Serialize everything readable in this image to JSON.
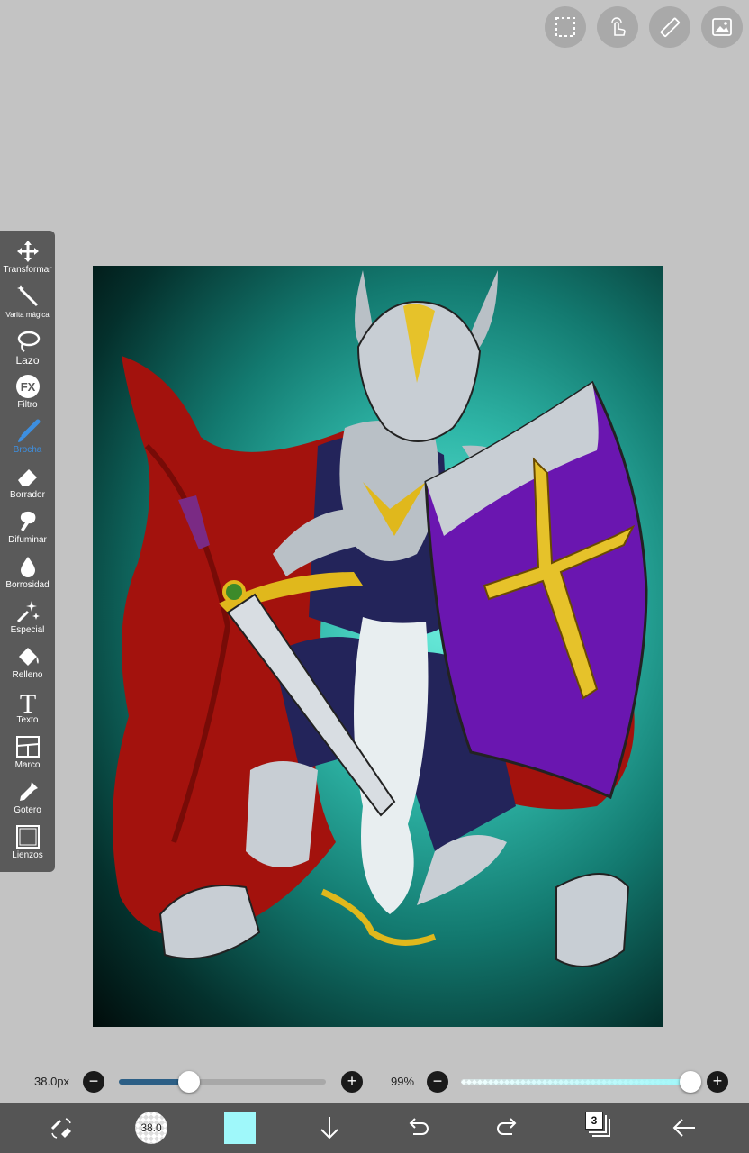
{
  "top_buttons": [
    {
      "name": "selection-icon"
    },
    {
      "name": "touch-gesture-icon"
    },
    {
      "name": "ruler-icon"
    },
    {
      "name": "reference-image-icon"
    }
  ],
  "toolbar": {
    "items": [
      {
        "label": "Transformar",
        "icon": "move-arrows-icon"
      },
      {
        "label": "Varita mágica",
        "icon": "magic-wand-icon"
      },
      {
        "label": "Lazo",
        "icon": "lasso-icon"
      },
      {
        "label": "Filtro",
        "icon": "fx-icon",
        "icon_text": "FX"
      },
      {
        "label": "Brocha",
        "icon": "brush-icon",
        "active": true
      },
      {
        "label": "Borrador",
        "icon": "eraser-icon"
      },
      {
        "label": "Difuminar",
        "icon": "smudge-finger-icon"
      },
      {
        "label": "Borrosidad",
        "icon": "blur-drop-icon"
      },
      {
        "label": "Especial",
        "icon": "sparkle-wand-icon"
      },
      {
        "label": "Relleno",
        "icon": "fill-bucket-icon"
      },
      {
        "label": "Texto",
        "icon": "text-t-icon",
        "icon_text": "T"
      },
      {
        "label": "Marco",
        "icon": "frame-divider-icon"
      },
      {
        "label": "Gotero",
        "icon": "eyedropper-icon"
      },
      {
        "label": "Lienzos",
        "icon": "canvas-icon"
      }
    ]
  },
  "sliders": {
    "size": {
      "value_label": "38.0px",
      "fraction": 0.34
    },
    "opacity": {
      "value_label": "99%",
      "fraction": 0.99
    },
    "minus": "−",
    "plus": "+"
  },
  "bottom_bar": {
    "brush_size_label": "38.0",
    "current_color": "#9ff8fa",
    "layer_count": "3",
    "icons": [
      "swap-tools-icon",
      "brush-size-icon",
      "color-swatch",
      "download-arrow-icon",
      "undo-icon",
      "redo-icon",
      "layers-icon",
      "back-arrow-icon"
    ]
  },
  "colors": {
    "toolbar_bg": "#5a5a5a",
    "active_tool": "#3d8fe0",
    "workspace_bg": "#c3c3c3",
    "slider_fill": "#2c5f86"
  }
}
